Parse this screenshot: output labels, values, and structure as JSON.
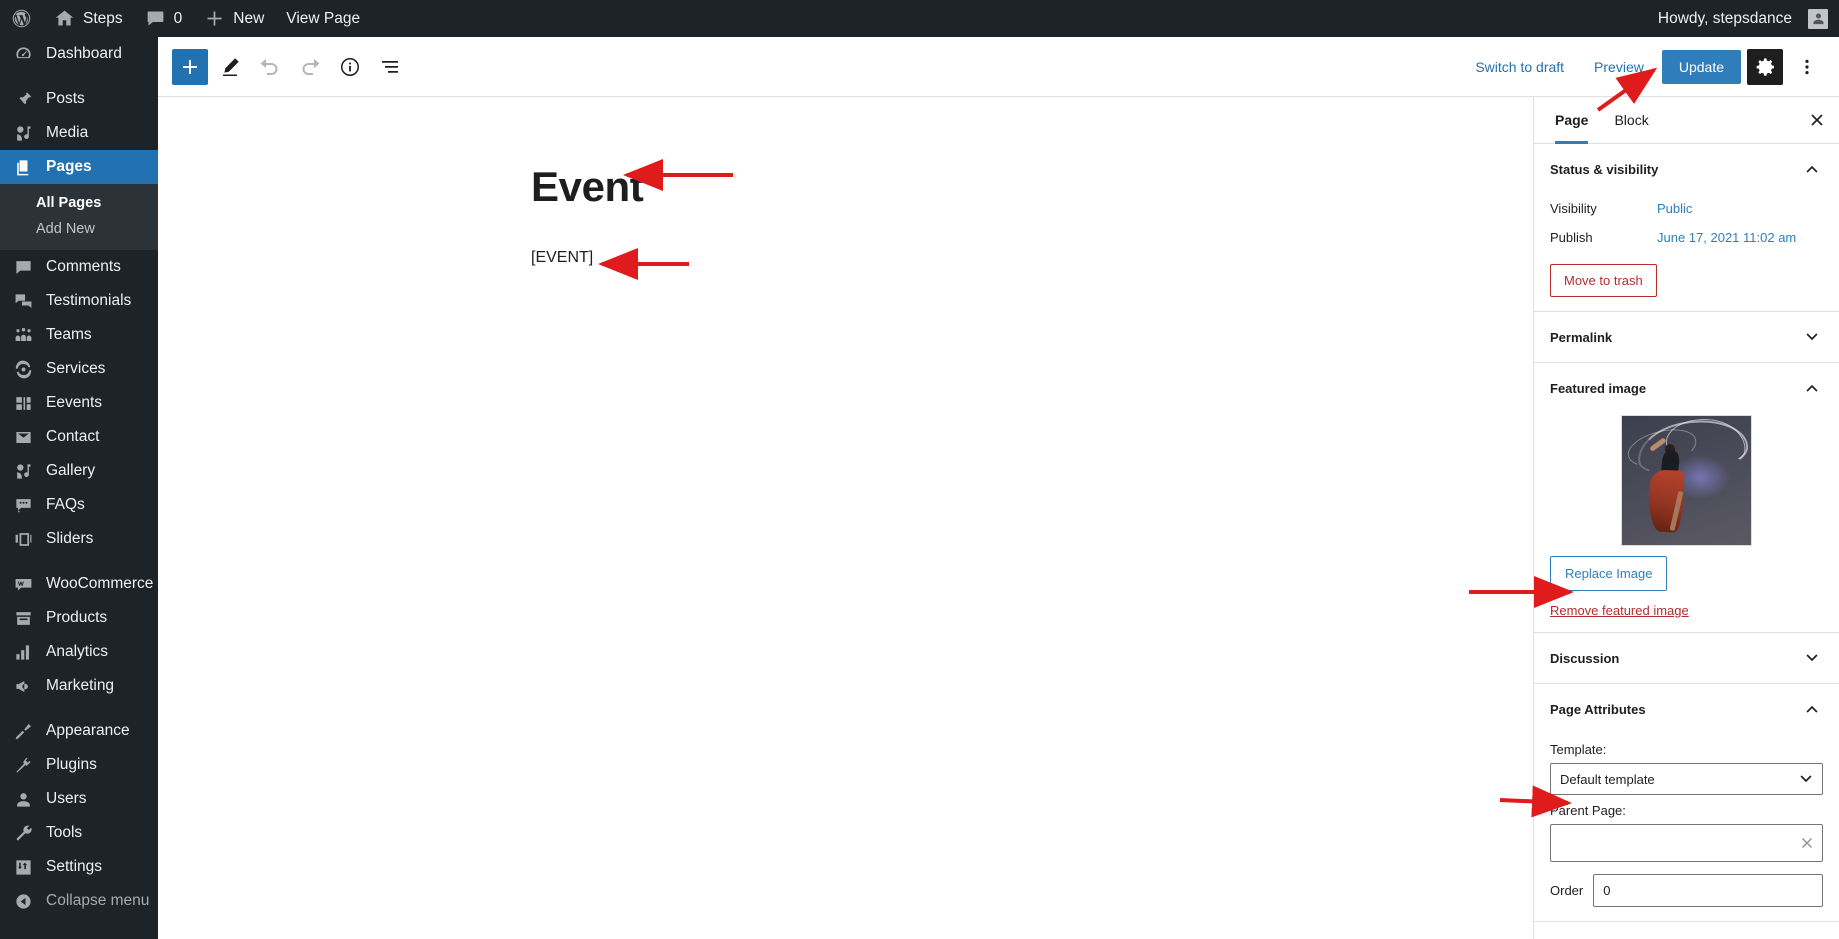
{
  "adminbar": {
    "wp_logo": "wordpress-logo-icon",
    "site_name": "Steps",
    "comments_count": "0",
    "new_label": "New",
    "view_page_label": "View Page",
    "howdy": "Howdy, stepsdance"
  },
  "adminmenu": {
    "items": [
      {
        "label": "Dashboard",
        "icon": "dashboard-icon",
        "current": false,
        "sep_before": false
      },
      {
        "label": "Posts",
        "icon": "pin-icon",
        "current": false,
        "sep_before": true
      },
      {
        "label": "Media",
        "icon": "media-icon",
        "current": false,
        "sep_before": false
      },
      {
        "label": "Pages",
        "icon": "pages-icon",
        "current": true,
        "sep_before": false
      },
      {
        "label": "Comments",
        "icon": "comment-icon",
        "current": false,
        "sep_before": false
      },
      {
        "label": "Testimonials",
        "icon": "testimonials-icon",
        "current": false,
        "sep_before": false
      },
      {
        "label": "Teams",
        "icon": "teams-icon",
        "current": false,
        "sep_before": false
      },
      {
        "label": "Services",
        "icon": "services-icon",
        "current": false,
        "sep_before": false
      },
      {
        "label": "Eevents",
        "icon": "events-icon",
        "current": false,
        "sep_before": false
      },
      {
        "label": "Contact",
        "icon": "envelope-icon",
        "current": false,
        "sep_before": false
      },
      {
        "label": "Gallery",
        "icon": "gallery-icon",
        "current": false,
        "sep_before": false
      },
      {
        "label": "FAQs",
        "icon": "faq-icon",
        "current": false,
        "sep_before": false
      },
      {
        "label": "Sliders",
        "icon": "sliders-icon",
        "current": false,
        "sep_before": false
      },
      {
        "label": "WooCommerce",
        "icon": "woocommerce-icon",
        "current": false,
        "sep_before": true
      },
      {
        "label": "Products",
        "icon": "products-icon",
        "current": false,
        "sep_before": false
      },
      {
        "label": "Analytics",
        "icon": "analytics-icon",
        "current": false,
        "sep_before": false
      },
      {
        "label": "Marketing",
        "icon": "marketing-icon",
        "current": false,
        "sep_before": false
      },
      {
        "label": "Appearance",
        "icon": "appearance-icon",
        "current": false,
        "sep_before": true
      },
      {
        "label": "Plugins",
        "icon": "plugins-icon",
        "current": false,
        "sep_before": false
      },
      {
        "label": "Users",
        "icon": "users-icon",
        "current": false,
        "sep_before": false
      },
      {
        "label": "Tools",
        "icon": "tools-icon",
        "current": false,
        "sep_before": false
      },
      {
        "label": "Settings",
        "icon": "settings-icon",
        "current": false,
        "sep_before": false
      }
    ],
    "submenu": {
      "all_pages": "All Pages",
      "add_new": "Add New"
    },
    "collapse": "Collapse menu"
  },
  "toolbar": {
    "add_block": "add-block-icon",
    "tools": "pencil-icon",
    "undo": "undo-icon",
    "redo": "redo-icon",
    "details": "info-icon",
    "list_view": "list-view-icon",
    "switch_to_draft": "Switch to draft",
    "preview": "Preview",
    "update": "Update",
    "settings_gear": "gear-icon",
    "more_menu": "kebab-menu-icon"
  },
  "content": {
    "title": "Event",
    "body": "[EVENT]"
  },
  "sidebar": {
    "tabs": [
      {
        "label": "Page",
        "active": true
      },
      {
        "label": "Block",
        "active": false
      }
    ],
    "close": "close-icon",
    "status": {
      "title": "Status & visibility",
      "expanded": true,
      "visibility_label": "Visibility",
      "visibility_value": "Public",
      "publish_label": "Publish",
      "publish_value": "June 17, 2021 11:02 am",
      "trash_label": "Move to trash"
    },
    "permalink": {
      "title": "Permalink",
      "expanded": false
    },
    "featured_image": {
      "title": "Featured image",
      "expanded": true,
      "image_alt": "dancer-with-flowing-fabric-thumbnail",
      "replace_label": "Replace Image",
      "remove_label": "Remove featured image"
    },
    "discussion": {
      "title": "Discussion",
      "expanded": false
    },
    "page_attributes": {
      "title": "Page Attributes",
      "expanded": true,
      "template_label": "Template:",
      "template_value": "Default template",
      "parent_label": "Parent Page:",
      "parent_value": "",
      "order_label": "Order",
      "order_value": "0"
    }
  },
  "annotations": {
    "color": "#e01b1b",
    "arrows": [
      {
        "name": "arrow-to-update-button"
      },
      {
        "name": "arrow-to-page-title"
      },
      {
        "name": "arrow-to-shortcode"
      },
      {
        "name": "arrow-to-replace-image"
      },
      {
        "name": "arrow-to-template-select"
      }
    ]
  },
  "colors": {
    "admin_dark": "#1d2327",
    "admin_current": "#2271b1",
    "accent_blue": "#2f7ebb",
    "danger_red": "#b32d2e",
    "annotation_red": "#e01b1b"
  }
}
